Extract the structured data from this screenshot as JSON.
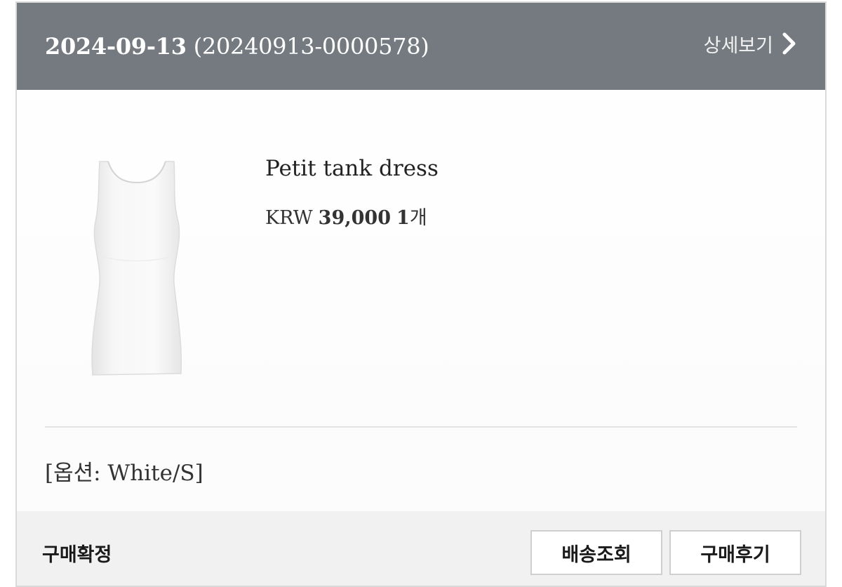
{
  "order": {
    "date": "2024-09-13",
    "number": "(20240913-0000578)",
    "detail_label": "상세보기"
  },
  "icons": {
    "detail_chevron": "chevron-right-icon",
    "product_thumb": "tank-dress-image"
  },
  "product": {
    "name": "Petit tank dress",
    "currency": "KRW",
    "price": "39,000",
    "quantity": "1",
    "quantity_unit": "개",
    "option": "[옵션: White/S]"
  },
  "footer": {
    "status": "구매확정",
    "track_button": "배송조회",
    "review_button": "구매후기"
  },
  "colors": {
    "header_bg": "#757a80",
    "footer_bg": "#f1f1f1",
    "button_border": "#cfcfcf"
  }
}
